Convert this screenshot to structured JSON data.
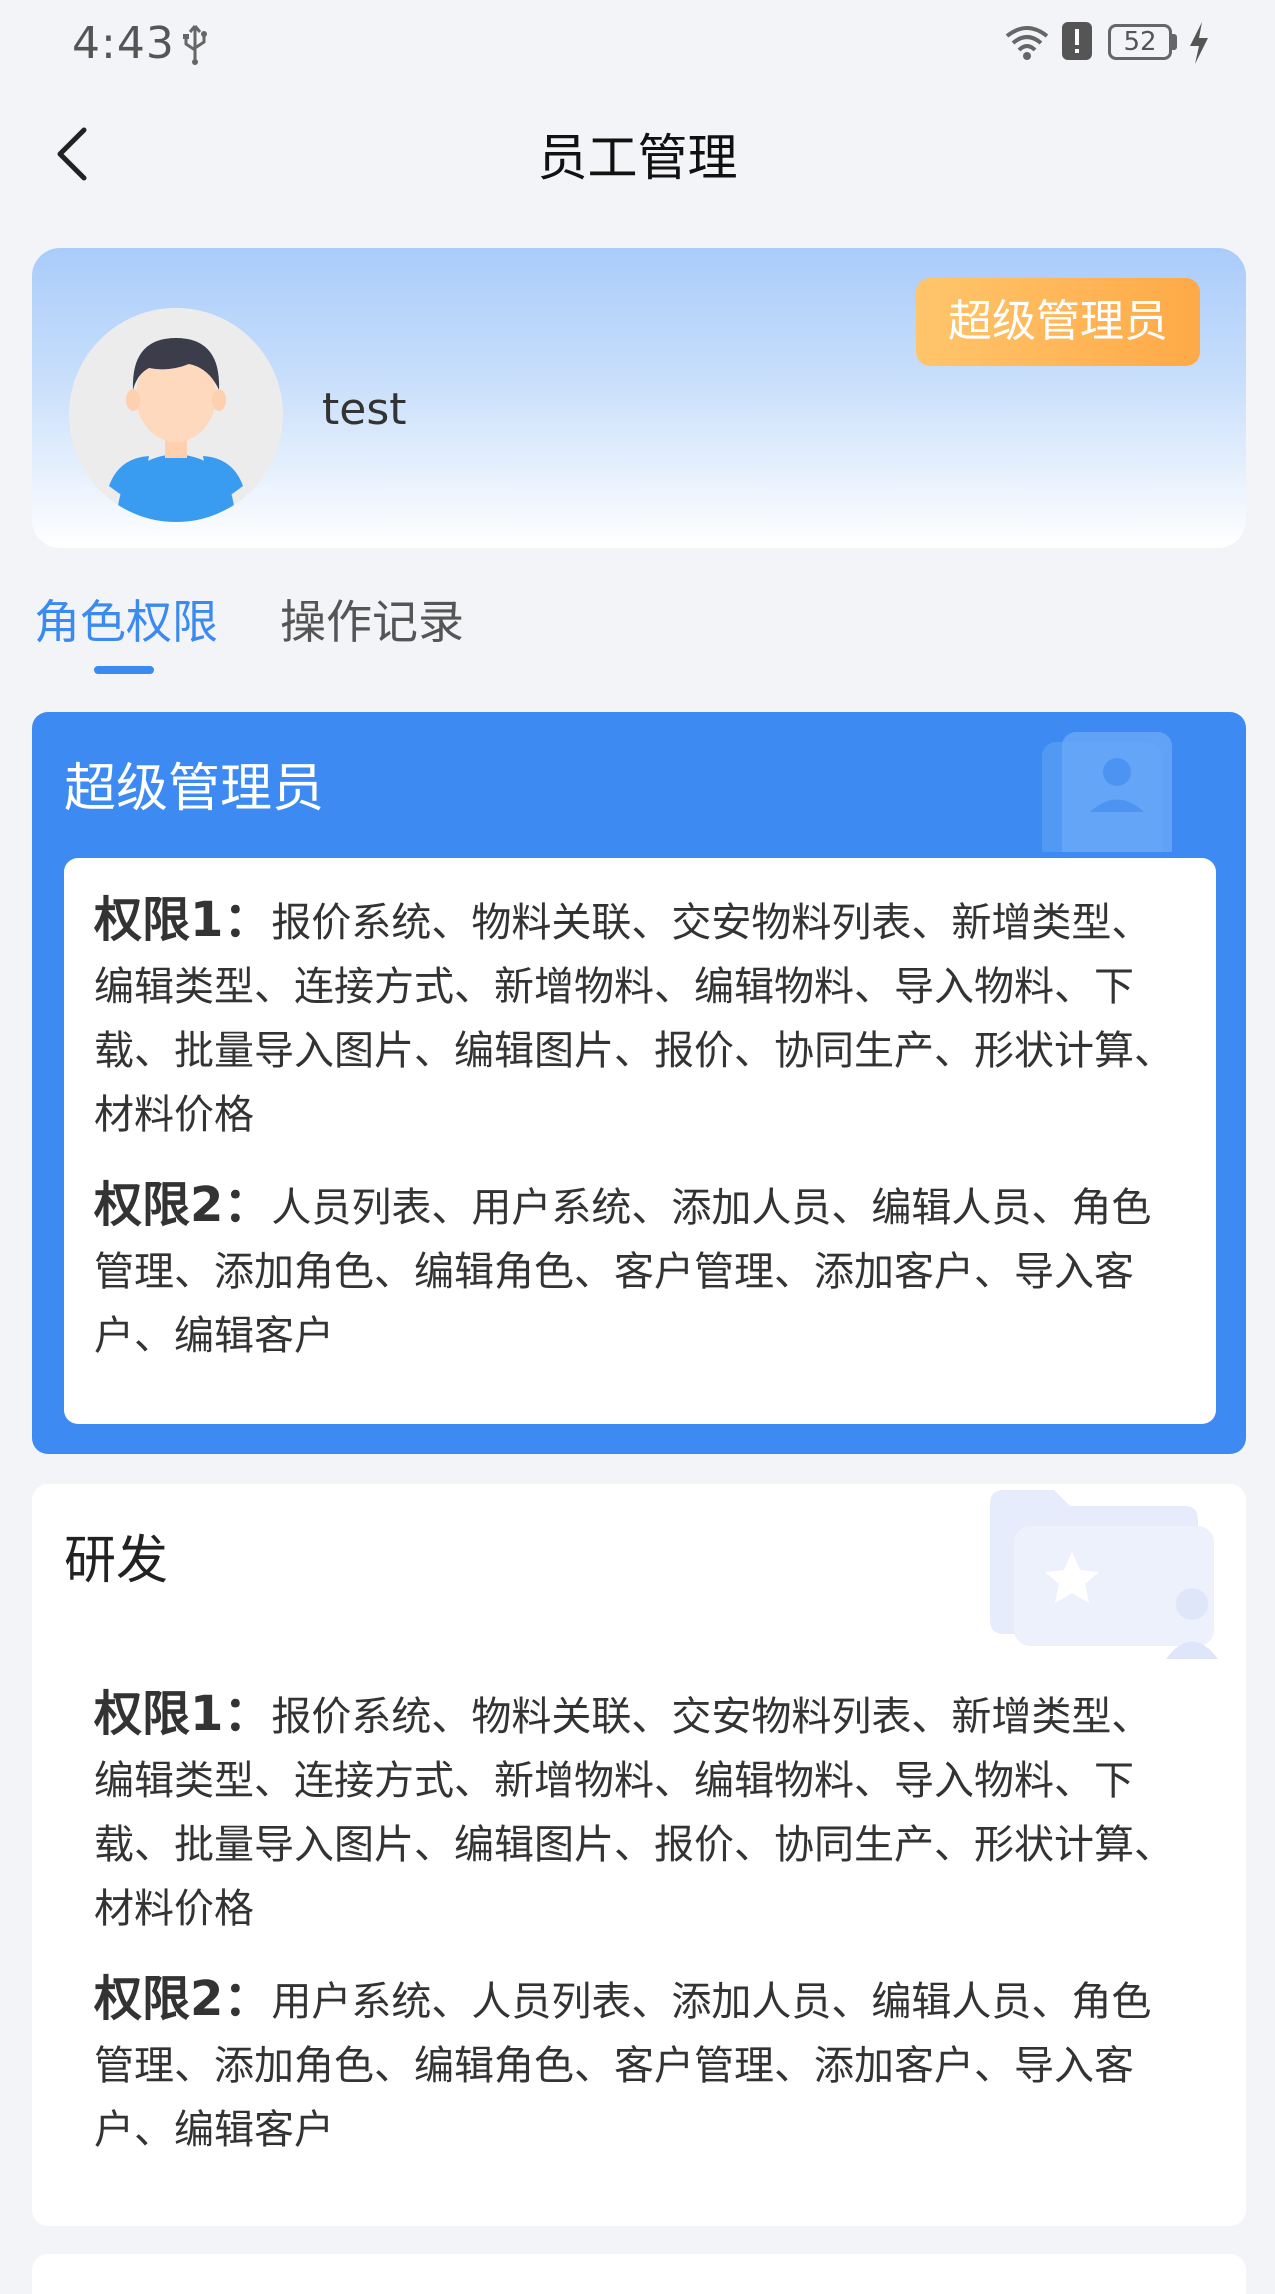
{
  "status_bar": {
    "time": "4:43",
    "battery": "52",
    "icons": [
      "usb-icon",
      "wifi-icon",
      "alert-icon",
      "battery-icon",
      "charging-icon"
    ]
  },
  "nav": {
    "title": "员工管理",
    "back_icon": "chevron-left-icon"
  },
  "profile": {
    "username": "test",
    "role_badge": "超级管理员"
  },
  "tabs": [
    {
      "label": "角色权限",
      "active": true
    },
    {
      "label": "操作记录",
      "active": false
    }
  ],
  "roles": [
    {
      "name": "超级管理员",
      "highlighted": true,
      "permissions": [
        {
          "label": "权限1：",
          "text": "报价系统、物料关联、交安物料列表、新增类型、编辑类型、连接方式、新增物料、编辑物料、导入物料、下载、批量导入图片、编辑图片、报价、协同生产、形状计算、材料价格"
        },
        {
          "label": "权限2：",
          "text": "人员列表、用户系统、添加人员、编辑人员、角色管理、添加角色、编辑角色、客户管理、添加客户、导入客户、编辑客户"
        }
      ]
    },
    {
      "name": "研发",
      "highlighted": false,
      "permissions": [
        {
          "label": "权限1：",
          "text": "报价系统、物料关联、交安物料列表、新增类型、编辑类型、连接方式、新增物料、编辑物料、导入物料、下载、批量导入图片、编辑图片、报价、协同生产、形状计算、材料价格"
        },
        {
          "label": "权限2：",
          "text": "用户系统、人员列表、添加人员、编辑人员、角色管理、添加角色、编辑角色、客户管理、添加客户、导入客户、编辑客户"
        }
      ]
    }
  ],
  "colors": {
    "accent": "#3d8bf2",
    "badge": "#ffa947",
    "background": "#f3f4f8"
  }
}
